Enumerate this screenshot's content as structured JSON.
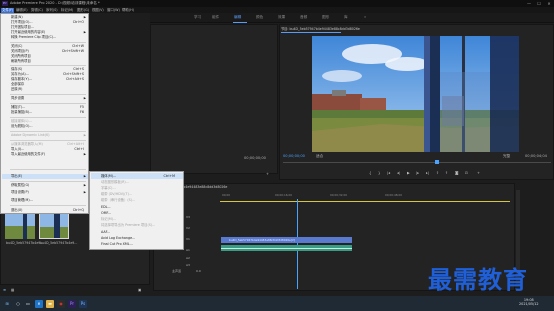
{
  "window": {
    "title": "Adobe Premiere Pro 2020 - D:\\视频\\培训课程\\未命名 *",
    "minimize": "—",
    "maximize": "☐",
    "close": "✕"
  },
  "menubar": [
    "文件(F)",
    "编辑(E)",
    "剪辑(C)",
    "序列(S)",
    "标记(M)",
    "图形(G)",
    "视图(V)",
    "窗口(W)",
    "帮助(H)"
  ],
  "workspace_tabs": [
    "学习",
    "组件",
    "编辑",
    "颜色",
    "效果",
    "音频",
    "图形",
    "库",
    "»"
  ],
  "file_menu": [
    {
      "label": "新建(N)",
      "shortcut": "",
      "submenu": true,
      "disabled": false
    },
    {
      "label": "打开项目(O)...",
      "shortcut": "Ctrl+O",
      "disabled": false
    },
    {
      "label": "打开团队项目...",
      "shortcut": "",
      "disabled": false
    },
    {
      "label": "打开最近使用的内容(E)",
      "shortcut": "",
      "submenu": true,
      "disabled": false
    },
    {
      "label": "转换 Premiere Clip 项目(C)...",
      "shortcut": "",
      "disabled": false
    },
    {
      "label": "关闭(C)",
      "shortcut": "Ctrl+W",
      "disabled": false
    },
    {
      "label": "关闭项目(P)",
      "shortcut": "Ctrl+Shift+W",
      "disabled": false
    },
    {
      "label": "关闭所有项目",
      "shortcut": "",
      "disabled": false
    },
    {
      "label": "刷新所有项目",
      "shortcut": "",
      "disabled": false
    },
    {
      "label": "保存(S)",
      "shortcut": "Ctrl+S",
      "disabled": false
    },
    {
      "label": "另存为(A)...",
      "shortcut": "Ctrl+Shift+S",
      "disabled": false
    },
    {
      "label": "保存副本(Y)...",
      "shortcut": "Ctrl+Alt+S",
      "disabled": false
    },
    {
      "label": "全部保存",
      "shortcut": "",
      "disabled": false
    },
    {
      "label": "还原(R)",
      "shortcut": "",
      "disabled": false
    },
    {
      "label": "同步设置",
      "shortcut": "",
      "submenu": true,
      "disabled": false
    },
    {
      "label": "捕捉(T)...",
      "shortcut": "F5",
      "disabled": false
    },
    {
      "label": "批量捕捉(B)...",
      "shortcut": "F6",
      "disabled": false
    },
    {
      "label": "链接媒体(L)...",
      "shortcut": "",
      "disabled": true
    },
    {
      "label": "设为脱机(O)...",
      "shortcut": "",
      "disabled": false
    },
    {
      "label": "Adobe Dynamic Link(K)",
      "shortcut": "",
      "submenu": true,
      "disabled": true
    },
    {
      "label": "从媒体浏览器导入(M)",
      "shortcut": "Ctrl+Alt+I",
      "disabled": true
    },
    {
      "label": "导入(I)...",
      "shortcut": "Ctrl+I",
      "disabled": false
    },
    {
      "label": "导入最近使用的文件(F)",
      "shortcut": "",
      "submenu": true,
      "disabled": false
    },
    {
      "label": "导出(E)",
      "shortcut": "",
      "submenu": true,
      "disabled": false,
      "highlighted": true
    },
    {
      "label": "获取属性(G)",
      "shortcut": "",
      "submenu": true,
      "disabled": false
    },
    {
      "label": "项目设置(P)",
      "shortcut": "",
      "submenu": true,
      "disabled": false
    },
    {
      "label": "项目管理(M)...",
      "shortcut": "",
      "disabled": false
    },
    {
      "label": "退出(X)",
      "shortcut": "Ctrl+Q",
      "disabled": false
    }
  ],
  "export_menu": [
    {
      "label": "媒体(M)...",
      "shortcut": "Ctrl+M",
      "disabled": false,
      "highlighted": true
    },
    {
      "label": "动态图形模板(R)...",
      "shortcut": "",
      "disabled": true
    },
    {
      "label": "字幕(C)...",
      "shortcut": "",
      "disabled": true
    },
    {
      "label": "磁带 (DV/HDV)(T)...",
      "shortcut": "",
      "disabled": true
    },
    {
      "label": "磁带（串行设备）(S)...",
      "shortcut": "",
      "disabled": true
    },
    {
      "label": "EDL...",
      "shortcut": "",
      "disabled": false
    },
    {
      "label": "OMF...",
      "shortcut": "",
      "disabled": false
    },
    {
      "label": "标记(M)...",
      "shortcut": "",
      "disabled": true
    },
    {
      "label": "将选择项导出为 Premiere 项目(S)...",
      "shortcut": "",
      "disabled": true
    },
    {
      "label": "AAF...",
      "shortcut": "",
      "disabled": false
    },
    {
      "label": "Avid Log Exchange...",
      "shortcut": "",
      "disabled": false
    },
    {
      "label": "Final Cut Pro XML...",
      "shortcut": "",
      "disabled": false
    }
  ],
  "source_monitor": {
    "timecode": "00;00;00;00"
  },
  "program_monitor": {
    "header": "节目: bu4D_5eb57947b4e94483e88c8dd3d8026e",
    "timecode_in": "00;00;00;00",
    "fit": "适合",
    "quality": "完整",
    "timecode_out": "00;00;04;04"
  },
  "project_panel": {
    "items": [
      {
        "label": "bu4D_5eb57947b4e9..."
      },
      {
        "label": "bu4D_5eb57947b4e9..."
      }
    ]
  },
  "timeline": {
    "header": "bu4D_5eb57947b4e94483e88c8dd3d8026e",
    "timecode": "00;00;00;00",
    "ruler": [
      "00;00",
      "00;00;16;00",
      "00;00;32;00",
      "00;00;48;00"
    ],
    "tracks": [
      "V3",
      "V2",
      "V1",
      "A1",
      "A2",
      "A3",
      "主声道"
    ],
    "video_clip": "bu4D_5eb57947b4e94483e88c8dd3d8026e[V]",
    "master_value": "0.0"
  },
  "watermark": "最需教育",
  "taskbar": {
    "time": "19:08",
    "date": "2021/05/12"
  },
  "colors": {
    "accent": "#5a9cf5",
    "timecode": "#4aa3ff",
    "menu_highlight": "#cce0f7",
    "clip": "#5a7ad0",
    "watermark": "#1f5fd8"
  }
}
